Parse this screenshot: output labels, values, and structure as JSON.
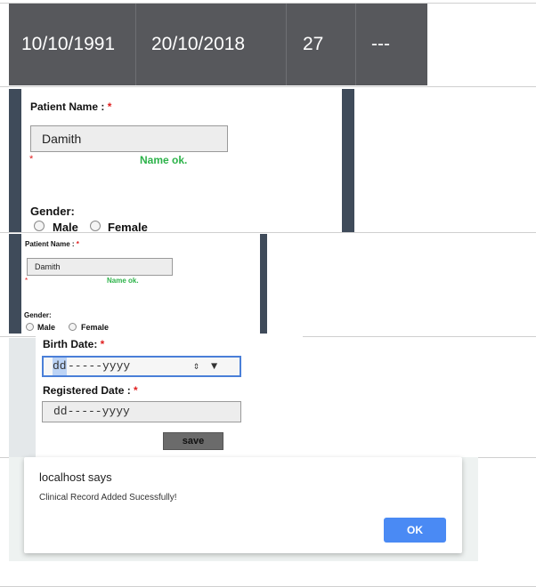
{
  "table_top_row": {
    "birth_date": "10/10/1991",
    "registered_date": "20/10/2018",
    "age": "27",
    "extra": "---"
  },
  "form_large": {
    "patient_name_label": "Patient Name : ",
    "required_mark": "*",
    "patient_name_value": "Damith",
    "name_status": "Name ok.",
    "gender_label": "Gender:",
    "male_label": "Male",
    "female_label": "Female"
  },
  "form_small": {
    "patient_name_label": "Patient Name : ",
    "required_mark": "*",
    "patient_name_value": "Damith",
    "name_status": "Name ok.",
    "gender_label": "Gender:",
    "male_label": "Male",
    "female_label": "Female"
  },
  "form_dates": {
    "birth_date_label": "Birth Date: ",
    "registered_date_label": "Registered Date : ",
    "required_mark": "*",
    "birth_date_segment_dd": "dd",
    "birth_date_rest": "-----yyyy",
    "registered_date_placeholder": "dd-----yyyy",
    "save_label": "save"
  },
  "alert": {
    "title": "localhost says",
    "message": "Clinical Record Added Sucessfully!",
    "ok_label": "OK"
  },
  "colors": {
    "dark_row": "#57585c",
    "ok_green": "#2db34a",
    "required_red": "#e02020",
    "ok_button_blue": "#4a8af4"
  }
}
